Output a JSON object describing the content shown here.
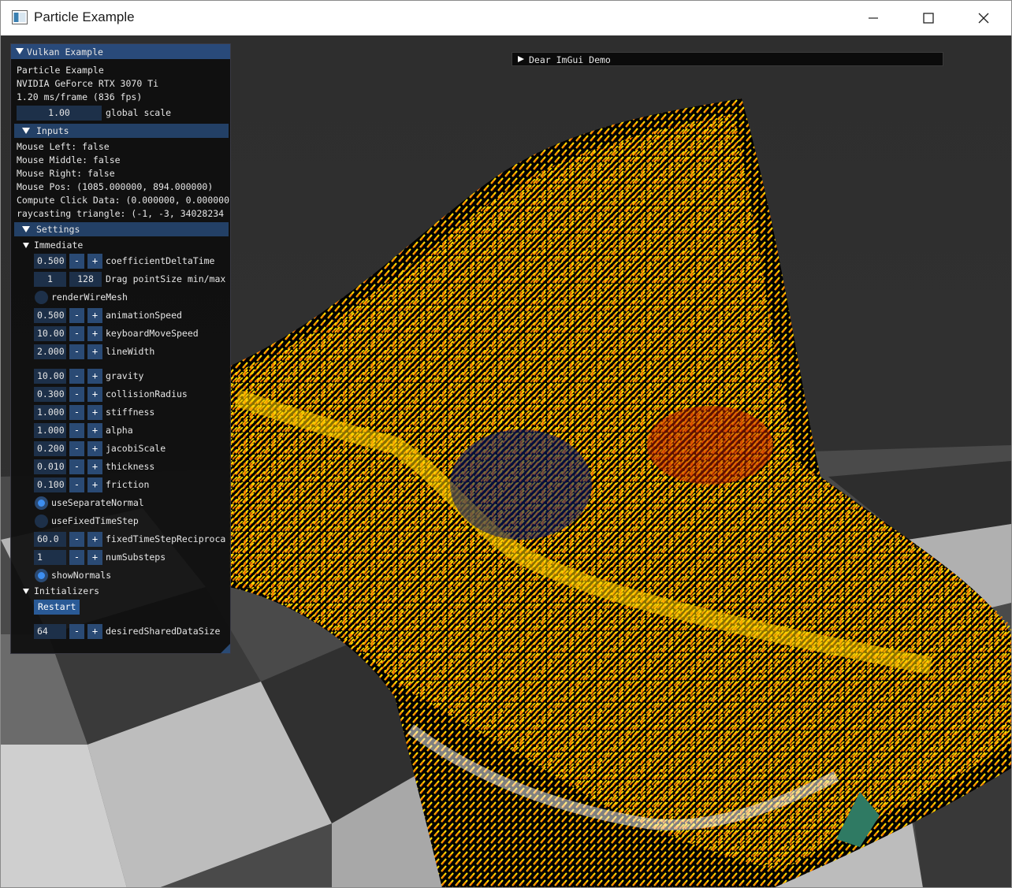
{
  "window": {
    "title": "Particle Example",
    "controls": [
      "minimize",
      "maximize",
      "close"
    ]
  },
  "panel": {
    "title": "Vulkan Example",
    "app_name": "Particle Example",
    "gpu": "NVIDIA GeForce RTX 3070 Ti",
    "frame_time": "1.20 ms/frame (836 fps)",
    "global_scale_value": "1.00",
    "global_scale_label": "global scale",
    "inputs_header": "Inputs",
    "inputs": [
      "Mouse Left: false",
      "Mouse Middle: false",
      "Mouse Right: false",
      "Mouse Pos: (1085.000000, 894.000000)",
      "Compute Click Data: (0.000000, 0.000000",
      "raycasting triangle: (-1, -3, 34028234"
    ],
    "settings_header": "Settings",
    "immediate_label": "Immediate",
    "coefficientDeltaTime": {
      "value": "0.500",
      "label": "coefficientDeltaTime"
    },
    "pointSize": {
      "min": "1",
      "max": "128",
      "label": "Drag pointSize min/max"
    },
    "renderWireMesh": {
      "label": "renderWireMesh",
      "checked": false
    },
    "animationSpeed": {
      "value": "0.500",
      "label": "animationSpeed"
    },
    "keyboardMoveSpeed": {
      "value": "10.00(",
      "label": "keyboardMoveSpeed"
    },
    "lineWidth": {
      "value": "2.000",
      "label": "lineWidth"
    },
    "gravity": {
      "value": "10.00(",
      "label": "gravity"
    },
    "collisionRadius": {
      "value": "0.300",
      "label": "collisionRadius"
    },
    "stiffness": {
      "value": "1.000",
      "label": "stiffness"
    },
    "alpha": {
      "value": "1.000",
      "label": "alpha"
    },
    "jacobiScale": {
      "value": "0.200",
      "label": "jacobiScale"
    },
    "thickness": {
      "value": "0.010",
      "label": "thickness"
    },
    "friction": {
      "value": "0.100",
      "label": "friction"
    },
    "useSeparateNormal": {
      "label": "useSeparateNormal",
      "checked": true
    },
    "useFixedTimeStep": {
      "label": "useFixedTimeStep",
      "checked": false
    },
    "fixedTimeStepReciprocal": {
      "value": "60.0",
      "label": "fixedTimeStepReciproca"
    },
    "numSubsteps": {
      "value": "1",
      "label": "numSubsteps"
    },
    "showNormals": {
      "label": "showNormals",
      "checked": true
    },
    "initializers_label": "Initializers",
    "restart_label": "Restart",
    "desiredSharedDataSize": {
      "value": "64",
      "label": "desiredSharedDataSize"
    },
    "minus": "-",
    "plus": "+"
  },
  "demo_window": {
    "title": "Dear ImGui Demo"
  },
  "colors": {
    "accent": "#3d8ef0",
    "header": "#234066",
    "particle_yellow": "#ffd800",
    "particle_orange": "#ff8a00",
    "floor_light": "#c8c8c8",
    "floor_dark": "#3a3a3a"
  }
}
